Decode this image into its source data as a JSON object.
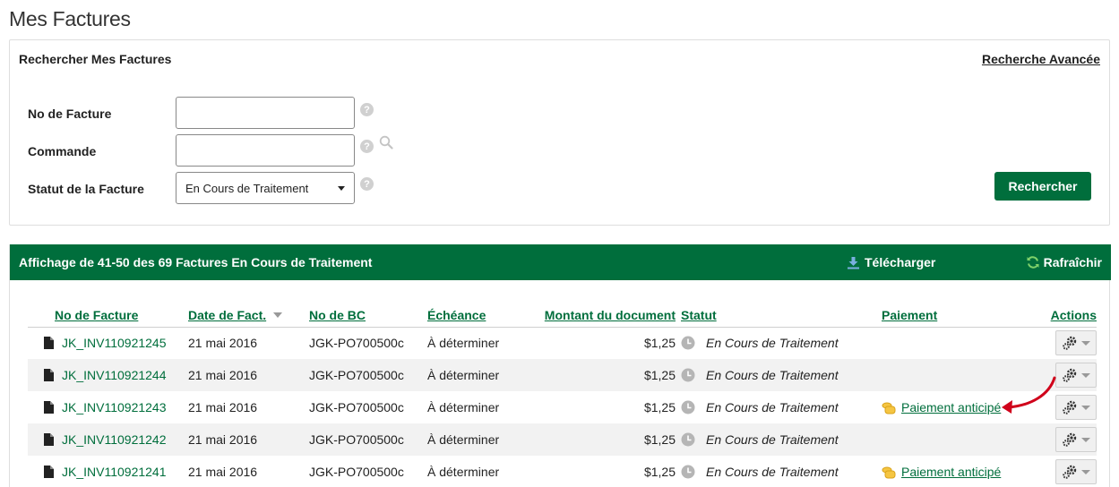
{
  "page_title": "Mes Factures",
  "search": {
    "title": "Rechercher Mes Factures",
    "advanced_link": "Recherche Avancée",
    "invoice_no_label": "No de Facture",
    "invoice_no_value": "",
    "order_label": "Commande",
    "order_value": "",
    "status_label": "Statut de la Facture",
    "status_selected": "En Cours de Traitement",
    "search_button": "Rechercher"
  },
  "results": {
    "title": "Affichage de 41-50 des 69 Factures En Cours de Traitement",
    "download": "Télécharger",
    "refresh": "Rafraîchir"
  },
  "table": {
    "columns": {
      "invoice_no": "No de Facture",
      "date": "Date de Fact.",
      "po_no": "No de BC",
      "due": "Échéance",
      "amount": "Montant du document",
      "status": "Statut",
      "payment": "Paiement",
      "actions": "Actions"
    },
    "rows": [
      {
        "invoice_no": "JK_INV110921245",
        "date": "21 mai 2016",
        "po_no": "JGK-PO700500c",
        "due": "À déterminer",
        "amount": "$1,25",
        "status": "En Cours de Traitement",
        "payment": ""
      },
      {
        "invoice_no": "JK_INV110921244",
        "date": "21 mai 2016",
        "po_no": "JGK-PO700500c",
        "due": "À déterminer",
        "amount": "$1,25",
        "status": "En Cours de Traitement",
        "payment": ""
      },
      {
        "invoice_no": "JK_INV110921243",
        "date": "21 mai 2016",
        "po_no": "JGK-PO700500c",
        "due": "À déterminer",
        "amount": "$1,25",
        "status": "En Cours de Traitement",
        "payment": "Paiement anticipé"
      },
      {
        "invoice_no": "JK_INV110921242",
        "date": "21 mai 2016",
        "po_no": "JGK-PO700500c",
        "due": "À déterminer",
        "amount": "$1,25",
        "status": "En Cours de Traitement",
        "payment": ""
      },
      {
        "invoice_no": "JK_INV110921241",
        "date": "21 mai 2016",
        "po_no": "JGK-PO700500c",
        "due": "À déterminer",
        "amount": "$1,25",
        "status": "En Cours de Traitement",
        "payment": "Paiement anticipé"
      }
    ]
  },
  "colors": {
    "brand_green": "#006e3c",
    "annotation_red": "#d0021b",
    "row_alt": "#f2f2f2"
  }
}
